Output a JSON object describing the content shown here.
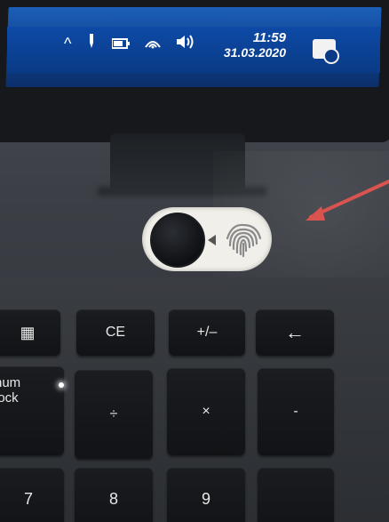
{
  "taskbar": {
    "icons": [
      "chevron-up-icon",
      "pen-icon",
      "battery-icon",
      "wifi-icon",
      "volume-icon"
    ],
    "time": "11:59",
    "date": "31.03.2020",
    "notification_icon": "notification-icon"
  },
  "privacy_shutter": {
    "icons": [
      "webcam-shutter-icon",
      "arrow-left-icon",
      "fingerprint-icon"
    ]
  },
  "annotation": {
    "arrow_color": "#d9534f"
  },
  "keyboard": {
    "row1": [
      "▦",
      "CE",
      "+/–",
      "←"
    ],
    "row2": [
      "num\nlock",
      "÷",
      "×",
      "-"
    ],
    "row3": [
      "7",
      "8",
      "9",
      ""
    ]
  },
  "colors": {
    "taskbar": "#0d4aa6",
    "key": "#15171a",
    "key_text": "#e8e8e8",
    "shutter": "#f1efe9"
  }
}
